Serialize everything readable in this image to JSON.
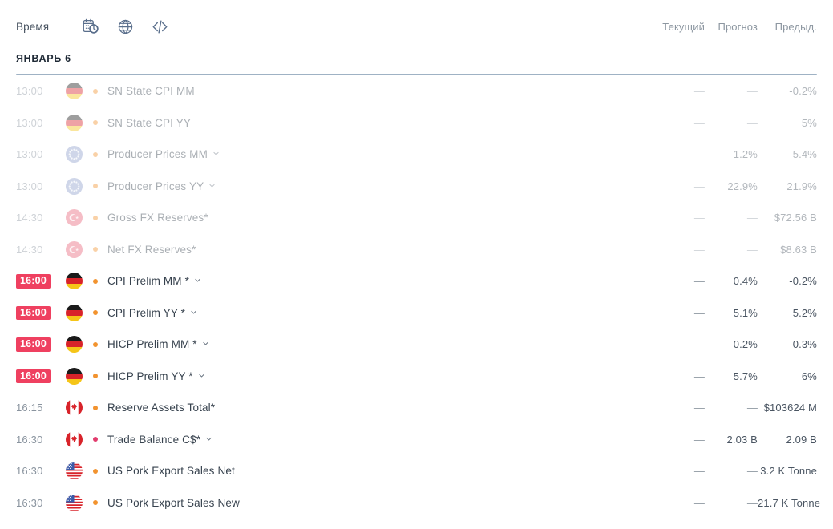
{
  "toolbar": {
    "time_label": "Время",
    "icons": [
      {
        "name": "calendar-clock-icon"
      },
      {
        "name": "globe-icon"
      },
      {
        "name": "code-embed-icon"
      }
    ],
    "columns": {
      "actual": "Текущий",
      "forecast": "Прогноз",
      "previous": "Предыд."
    }
  },
  "date_group": {
    "title": "ЯНВАРЬ 6"
  },
  "colors": {
    "badge_bg": "#ef4060",
    "badge_text": "#ffffff",
    "importance_medium": "#f2932f",
    "importance_high": "#e23b6d",
    "rule": "#9fb2c4",
    "text": "#37424e",
    "muted": "#8d97a1"
  },
  "rows": [
    {
      "time": "13:00",
      "time_highlighted": false,
      "faded": true,
      "flag": "flag-germany",
      "country": "Германия",
      "importance": "medium",
      "event": "SN State CPI MM",
      "expandable": false,
      "actual": "—",
      "forecast": "—",
      "previous": "-0.2%"
    },
    {
      "time": "13:00",
      "time_highlighted": false,
      "faded": true,
      "flag": "flag-germany",
      "country": "Германия",
      "importance": "medium",
      "event": "SN State CPI YY",
      "expandable": false,
      "actual": "—",
      "forecast": "—",
      "previous": "5%"
    },
    {
      "time": "13:00",
      "time_highlighted": false,
      "faded": true,
      "flag": "flag-eu",
      "country": "Еврозона",
      "importance": "medium",
      "event": "Producer Prices MM",
      "expandable": true,
      "actual": "—",
      "forecast": "1.2%",
      "previous": "5.4%"
    },
    {
      "time": "13:00",
      "time_highlighted": false,
      "faded": true,
      "flag": "flag-eu",
      "country": "Еврозона",
      "importance": "medium",
      "event": "Producer Prices YY",
      "expandable": true,
      "actual": "—",
      "forecast": "22.9%",
      "previous": "21.9%"
    },
    {
      "time": "14:30",
      "time_highlighted": false,
      "faded": true,
      "flag": "flag-turkey",
      "country": "Турция",
      "importance": "medium",
      "event": "Gross FX Reserves*",
      "expandable": false,
      "actual": "—",
      "forecast": "—",
      "previous": "$72.56 B"
    },
    {
      "time": "14:30",
      "time_highlighted": false,
      "faded": true,
      "flag": "flag-turkey",
      "country": "Турция",
      "importance": "medium",
      "event": "Net FX Reserves*",
      "expandable": false,
      "actual": "—",
      "forecast": "—",
      "previous": "$8.63 B"
    },
    {
      "time": "16:00",
      "time_highlighted": true,
      "faded": false,
      "flag": "flag-germany",
      "country": "Германия",
      "importance": "medium",
      "event": "CPI Prelim MM *",
      "expandable": true,
      "actual": "—",
      "forecast": "0.4%",
      "previous": "-0.2%"
    },
    {
      "time": "16:00",
      "time_highlighted": true,
      "faded": false,
      "flag": "flag-germany",
      "country": "Германия",
      "importance": "medium",
      "event": "CPI Prelim YY *",
      "expandable": true,
      "actual": "—",
      "forecast": "5.1%",
      "previous": "5.2%"
    },
    {
      "time": "16:00",
      "time_highlighted": true,
      "faded": false,
      "flag": "flag-germany",
      "country": "Германия",
      "importance": "medium",
      "event": "HICP Prelim MM *",
      "expandable": true,
      "actual": "—",
      "forecast": "0.2%",
      "previous": "0.3%"
    },
    {
      "time": "16:00",
      "time_highlighted": true,
      "faded": false,
      "flag": "flag-germany",
      "country": "Германия",
      "importance": "medium",
      "event": "HICP Prelim YY *",
      "expandable": true,
      "actual": "—",
      "forecast": "5.7%",
      "previous": "6%"
    },
    {
      "time": "16:15",
      "time_highlighted": false,
      "faded": false,
      "flag": "flag-canada",
      "country": "Канада",
      "importance": "medium",
      "event": "Reserve Assets Total*",
      "expandable": false,
      "actual": "—",
      "forecast": "—",
      "previous": "$103624 M"
    },
    {
      "time": "16:30",
      "time_highlighted": false,
      "faded": false,
      "flag": "flag-canada",
      "country": "Канада",
      "importance": "high",
      "event": "Trade Balance C$*",
      "expandable": true,
      "actual": "—",
      "forecast": "2.03 B",
      "previous": "2.09 B"
    },
    {
      "time": "16:30",
      "time_highlighted": false,
      "faded": false,
      "flag": "flag-usa",
      "country": "США",
      "importance": "medium",
      "event": "US Pork Export Sales Net",
      "expandable": false,
      "actual": "—",
      "forecast": "—",
      "previous": "3.2 K Tonne"
    },
    {
      "time": "16:30",
      "time_highlighted": false,
      "faded": false,
      "flag": "flag-usa",
      "country": "США",
      "importance": "medium",
      "event": "US Pork Export Sales New",
      "expandable": false,
      "actual": "—",
      "forecast": "—",
      "previous": "21.7 K Tonne"
    }
  ]
}
